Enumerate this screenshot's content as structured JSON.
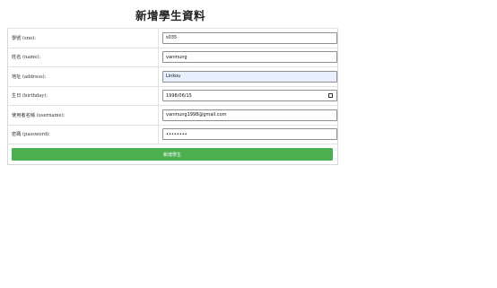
{
  "page": {
    "title": "新增學生資料"
  },
  "form": {
    "fields": [
      {
        "label": "學號 (sno):",
        "value": "s035"
      },
      {
        "label": "姓名 (name):",
        "value": "vanmung"
      },
      {
        "label": "地址 (address):",
        "value": "Linkou"
      },
      {
        "label": "生日 (birthday):",
        "value": "1998/06/15"
      },
      {
        "label": "使用者名稱 (username):",
        "value": "vanmung1998@gmail.com"
      },
      {
        "label": "密碼 (password):",
        "value": "••••••••"
      }
    ],
    "submit_label": "新增學生"
  },
  "colors": {
    "submit_bg": "#4caf50",
    "autofill_bg": "#e8f0fe"
  },
  "icons": {
    "date_picker": "calendar-icon"
  }
}
